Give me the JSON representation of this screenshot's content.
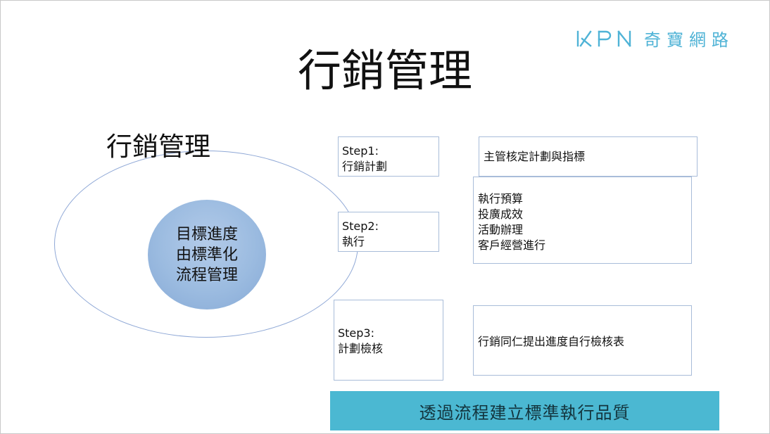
{
  "logo": {
    "mark": "KPN",
    "text": "奇寶網路",
    "color": "#4fb3d6"
  },
  "title": "行銷管理",
  "ellipse": {
    "label": "行銷管理",
    "circle_lines": [
      "目標進度",
      "由標準化",
      "流程管理"
    ]
  },
  "steps": [
    {
      "lines": [
        "Step1:",
        "行銷計劃"
      ]
    },
    {
      "lines": [
        "Step2:",
        "執行"
      ]
    },
    {
      "lines": [
        "Step3:",
        "計劃檢核"
      ]
    }
  ],
  "results": [
    {
      "lines": [
        "主管核定計劃與指標"
      ]
    },
    {
      "lines": [
        "執行預算",
        "投廣成效",
        "活動辦理",
        "客戶經營進行"
      ]
    },
    {
      "lines": [
        "行銷同仁提出進度自行檢核表"
      ]
    }
  ],
  "banner": {
    "text": "透過流程建立標準執行品質",
    "color": "#4bb8d2"
  }
}
